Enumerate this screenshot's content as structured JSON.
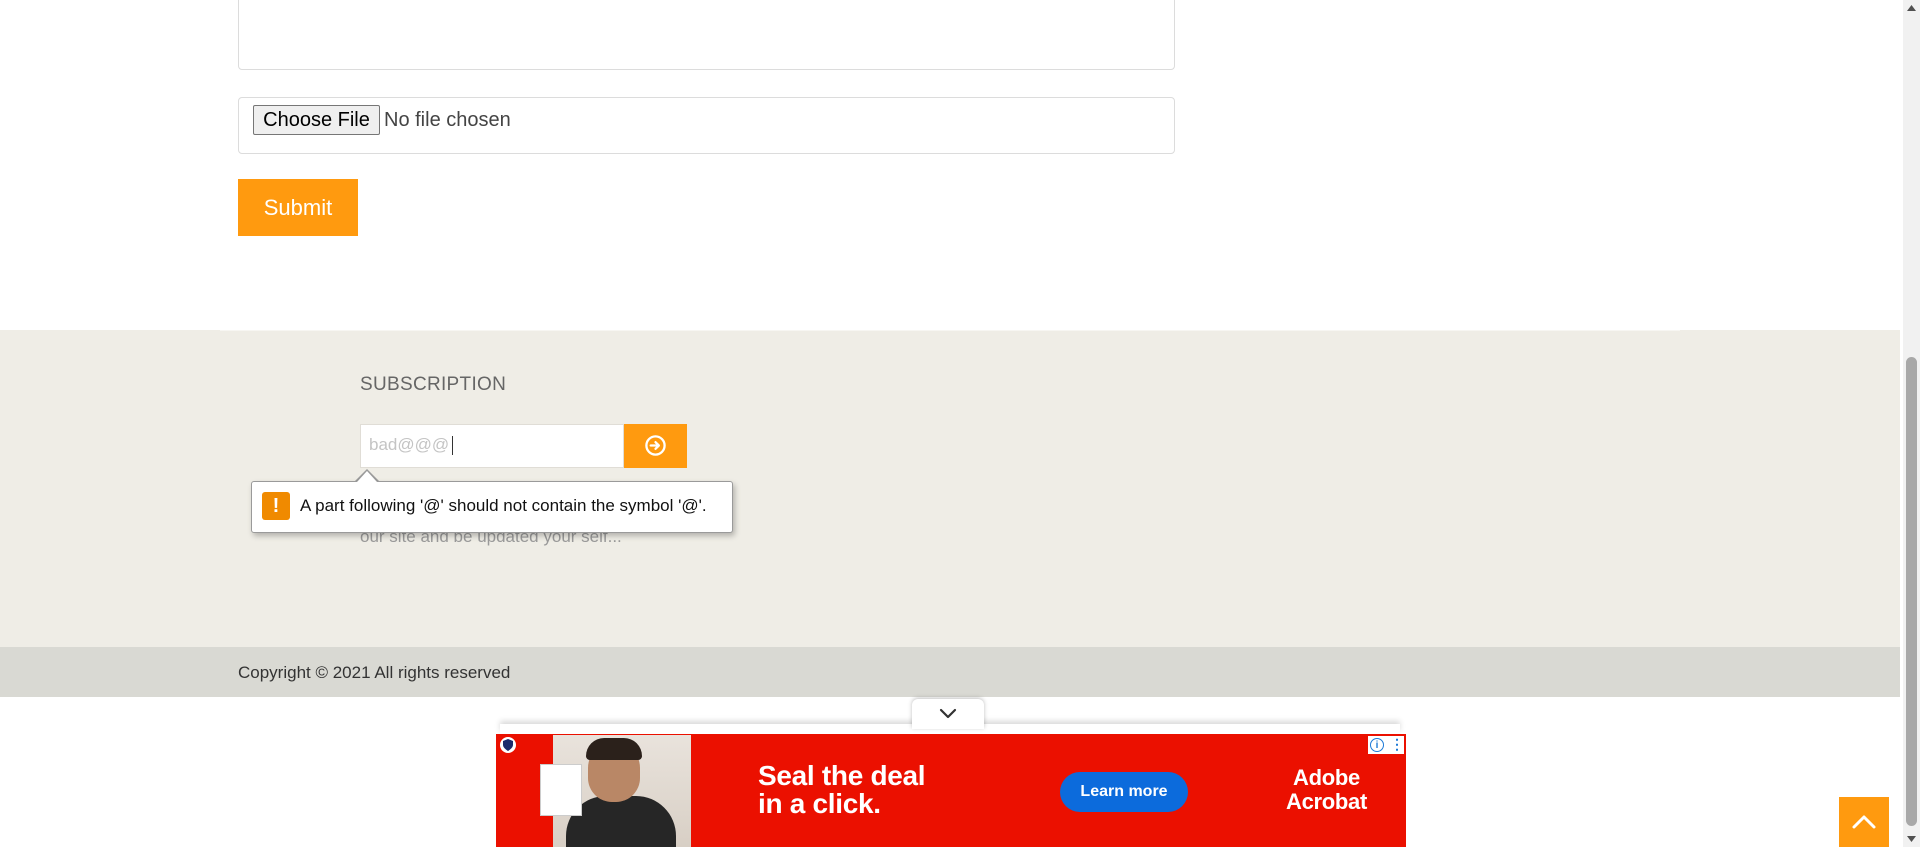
{
  "form": {
    "file_button_label": "Choose File",
    "file_status": "No file chosen",
    "submit_label": "Submit"
  },
  "subscription": {
    "heading": "SUBSCRIPTION",
    "email_value": "bad@@@",
    "description": "our site and be updated your self...",
    "submit_icon": "arrow-circle-right-icon"
  },
  "validation_tooltip": {
    "icon": "warning-icon",
    "message": "A part following '@' should not contain the symbol '@'."
  },
  "footer": {
    "copyright": "Copyright © 2021 All rights reserved"
  },
  "ad": {
    "headline_line1": "Seal the deal",
    "headline_line2": "in a click.",
    "cta_label": "Learn more",
    "brand_line1": "Adobe",
    "brand_line2": "Acrobat",
    "background_color": "#eb1000",
    "cta_color": "#0c6bdc"
  },
  "colors": {
    "accent": "#ff9a0f",
    "subscription_band": "#efede6",
    "copyright_band": "#d9d9d3"
  }
}
